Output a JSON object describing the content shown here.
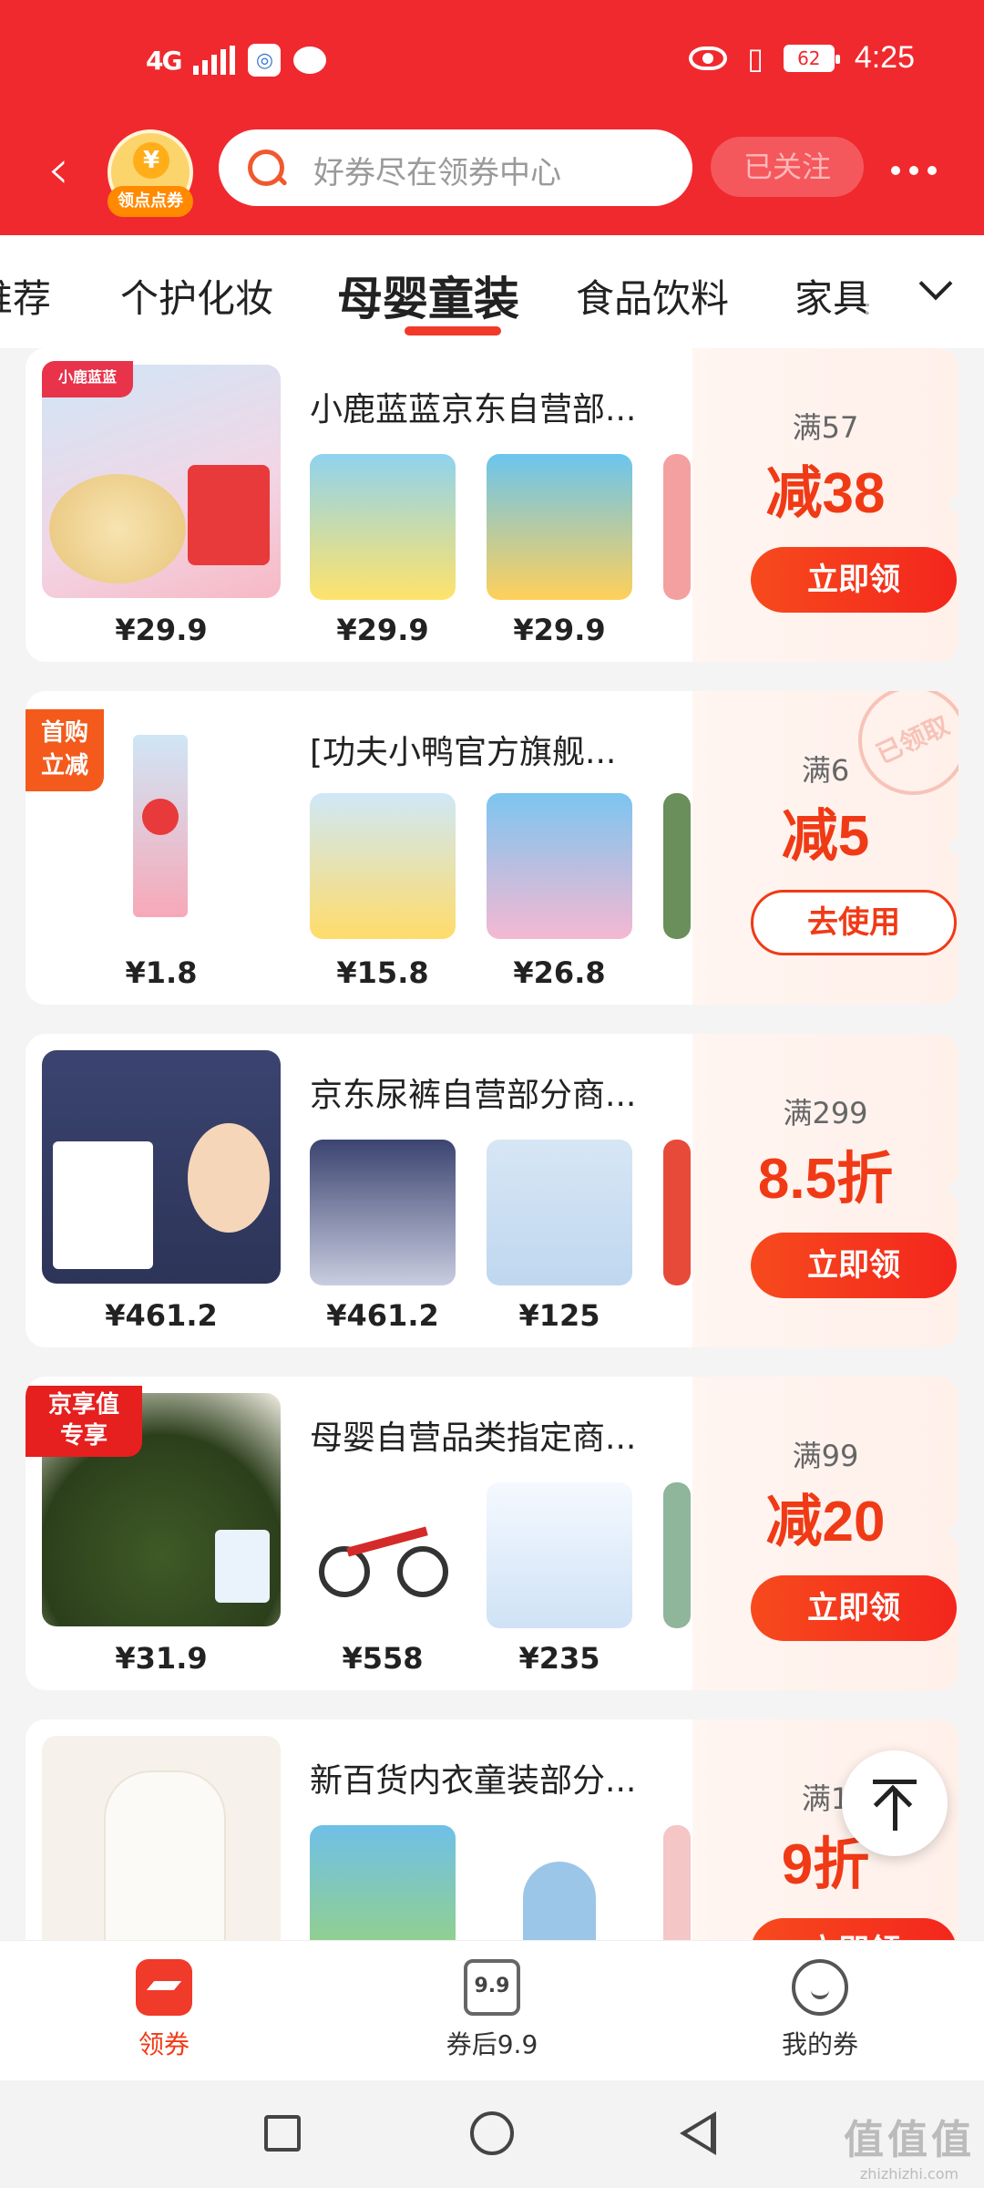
{
  "status": {
    "network": "4G",
    "battery": "62",
    "time": "4:25"
  },
  "header": {
    "coin_label": "领点点券",
    "coin_symbol": "¥",
    "search_placeholder": "好券尽在领券中心",
    "follow_label": "已关注"
  },
  "tabs": [
    {
      "label": "推荐"
    },
    {
      "label": "个护化妆"
    },
    {
      "label": "母婴童装",
      "active": true
    },
    {
      "label": "食品饮料"
    },
    {
      "label": "家具"
    }
  ],
  "cards": [
    {
      "shop": "小鹿蓝蓝京东自营部...",
      "condition": "满57",
      "discount": "减38",
      "button": "立即领",
      "prices": [
        "¥29.9",
        "¥29.9",
        "¥29.9"
      ]
    },
    {
      "shop": "[功夫小鸭官方旗舰...",
      "condition": "满6",
      "discount": "减5",
      "button": "去使用",
      "tag": "首购\n立减",
      "stamp": "已领取",
      "prices": [
        "¥1.8",
        "¥15.8",
        "¥26.8"
      ]
    },
    {
      "shop": "京东尿裤自营部分商...",
      "condition": "满299",
      "discount": "8.5折",
      "button": "立即领",
      "prices": [
        "¥461.2",
        "¥461.2",
        "¥125"
      ]
    },
    {
      "shop": "母婴自营品类指定商...",
      "condition": "满99",
      "discount": "减20",
      "button": "立即领",
      "tag": "京享值\n专享",
      "prices": [
        "¥31.9",
        "¥558",
        "¥235"
      ]
    },
    {
      "shop": "新百货内衣童装部分...",
      "condition": "满1",
      "discount": "9折",
      "button": "立即领",
      "prices": []
    }
  ],
  "bottom_nav": [
    {
      "label": "领券",
      "icon": "coupon-icon"
    },
    {
      "label": "券后9.9",
      "icon": "price-99-icon",
      "icon_text": "9.9"
    },
    {
      "label": "我的券",
      "icon": "my-coupon-icon"
    }
  ],
  "watermark": {
    "logo": "值值值",
    "site": "zhizhizhi.com"
  },
  "colors": {
    "brand_red": "#f0292e",
    "accent_orange": "#f03a16"
  }
}
